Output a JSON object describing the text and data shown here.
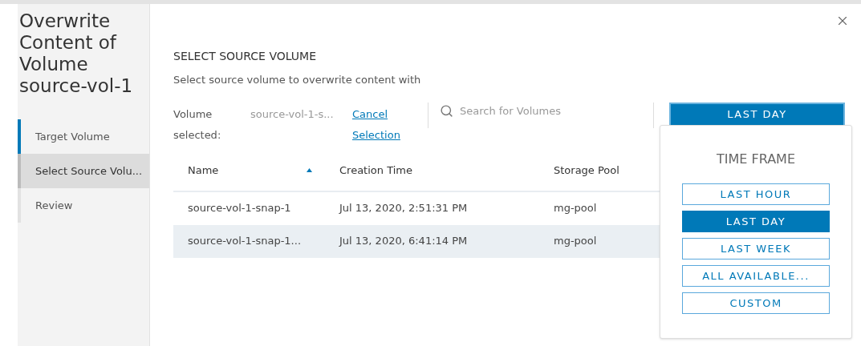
{
  "wizard": {
    "title": "Overwrite Content of Volume source-vol-1",
    "steps": [
      {
        "label": "Target Volume",
        "completed": true,
        "selected": false
      },
      {
        "label": "Select Source Volu...",
        "completed": false,
        "selected": true
      },
      {
        "label": "Review",
        "completed": false,
        "selected": false
      }
    ]
  },
  "page": {
    "heading": "SELECT SOURCE VOLUME",
    "description": "Select source volume to overwrite content with",
    "selection": {
      "label": "Volume selected:",
      "value": "source-vol-1-s...",
      "cancel_link": "Cancel Selection"
    },
    "search": {
      "placeholder": "Search for Volumes"
    },
    "time_button": "LAST DAY",
    "table": {
      "columns": [
        {
          "label": "Name",
          "sorted": true
        },
        {
          "label": "Creation Time",
          "sorted": false
        },
        {
          "label": "Storage Pool",
          "sorted": false
        }
      ],
      "rows": [
        {
          "cells": [
            "source-vol-1-snap-1",
            "Jul 13, 2020, 2:51:31 PM",
            "mg-pool"
          ],
          "selected": false
        },
        {
          "cells": [
            "source-vol-1-snap-1...",
            "Jul 13, 2020, 6:41:14 PM",
            "mg-pool"
          ],
          "selected": true
        }
      ]
    },
    "dropdown": {
      "title": "TIME FRAME",
      "options": [
        {
          "label": "LAST HOUR",
          "selected": false
        },
        {
          "label": "LAST DAY",
          "selected": true
        },
        {
          "label": "LAST WEEK",
          "selected": false
        },
        {
          "label": "ALL AVAILABLE...",
          "selected": false
        },
        {
          "label": "CUSTOM",
          "selected": false
        }
      ]
    }
  }
}
